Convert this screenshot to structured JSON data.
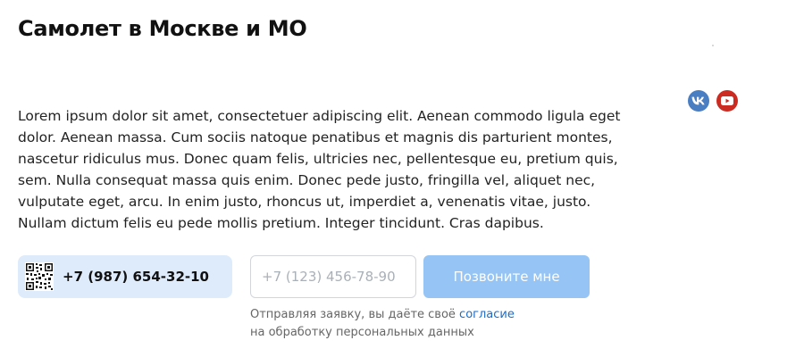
{
  "page": {
    "title": "Самолет в Москве и МО",
    "description": "Lorem ipsum dolor sit amet, consectetuer adipiscing elit. Aenean commodo ligula eget dolor. Aenean massa. Cum sociis natoque penatibus et magnis dis parturient montes, nascetur ridiculus mus. Donec quam felis, ultricies nec, pellentesque eu, pretium quis, sem. Nulla consequat massa quis enim. Donec pede justo, fringilla vel, aliquet nec, vulputate eget, arcu. In enim justo, rhoncus ut, imperdiet a, venenatis vitae, justo. Nullam dictum felis eu pede mollis pretium. Integer tincidunt. Cras dapibus."
  },
  "social": {
    "items": [
      {
        "icon": "vk-icon",
        "color": "#4a7ec2"
      },
      {
        "icon": "youtube-icon",
        "color": "#cc2b22"
      }
    ]
  },
  "contact": {
    "phone": "+7 (987) 654-32-10",
    "qr_icon": "qr-code-icon",
    "card_color": "#deebfb"
  },
  "form": {
    "phone_placeholder": "+7 (123) 456-78-90",
    "phone_value": "",
    "submit_label": "Позвоните мне",
    "submit_color": "#96c4f4"
  },
  "consent": {
    "before": "Отправляя заявку, вы даёте своё ",
    "link": "согласие",
    "after": "на обработку персональных данных",
    "link_color": "#1a6dcc"
  }
}
